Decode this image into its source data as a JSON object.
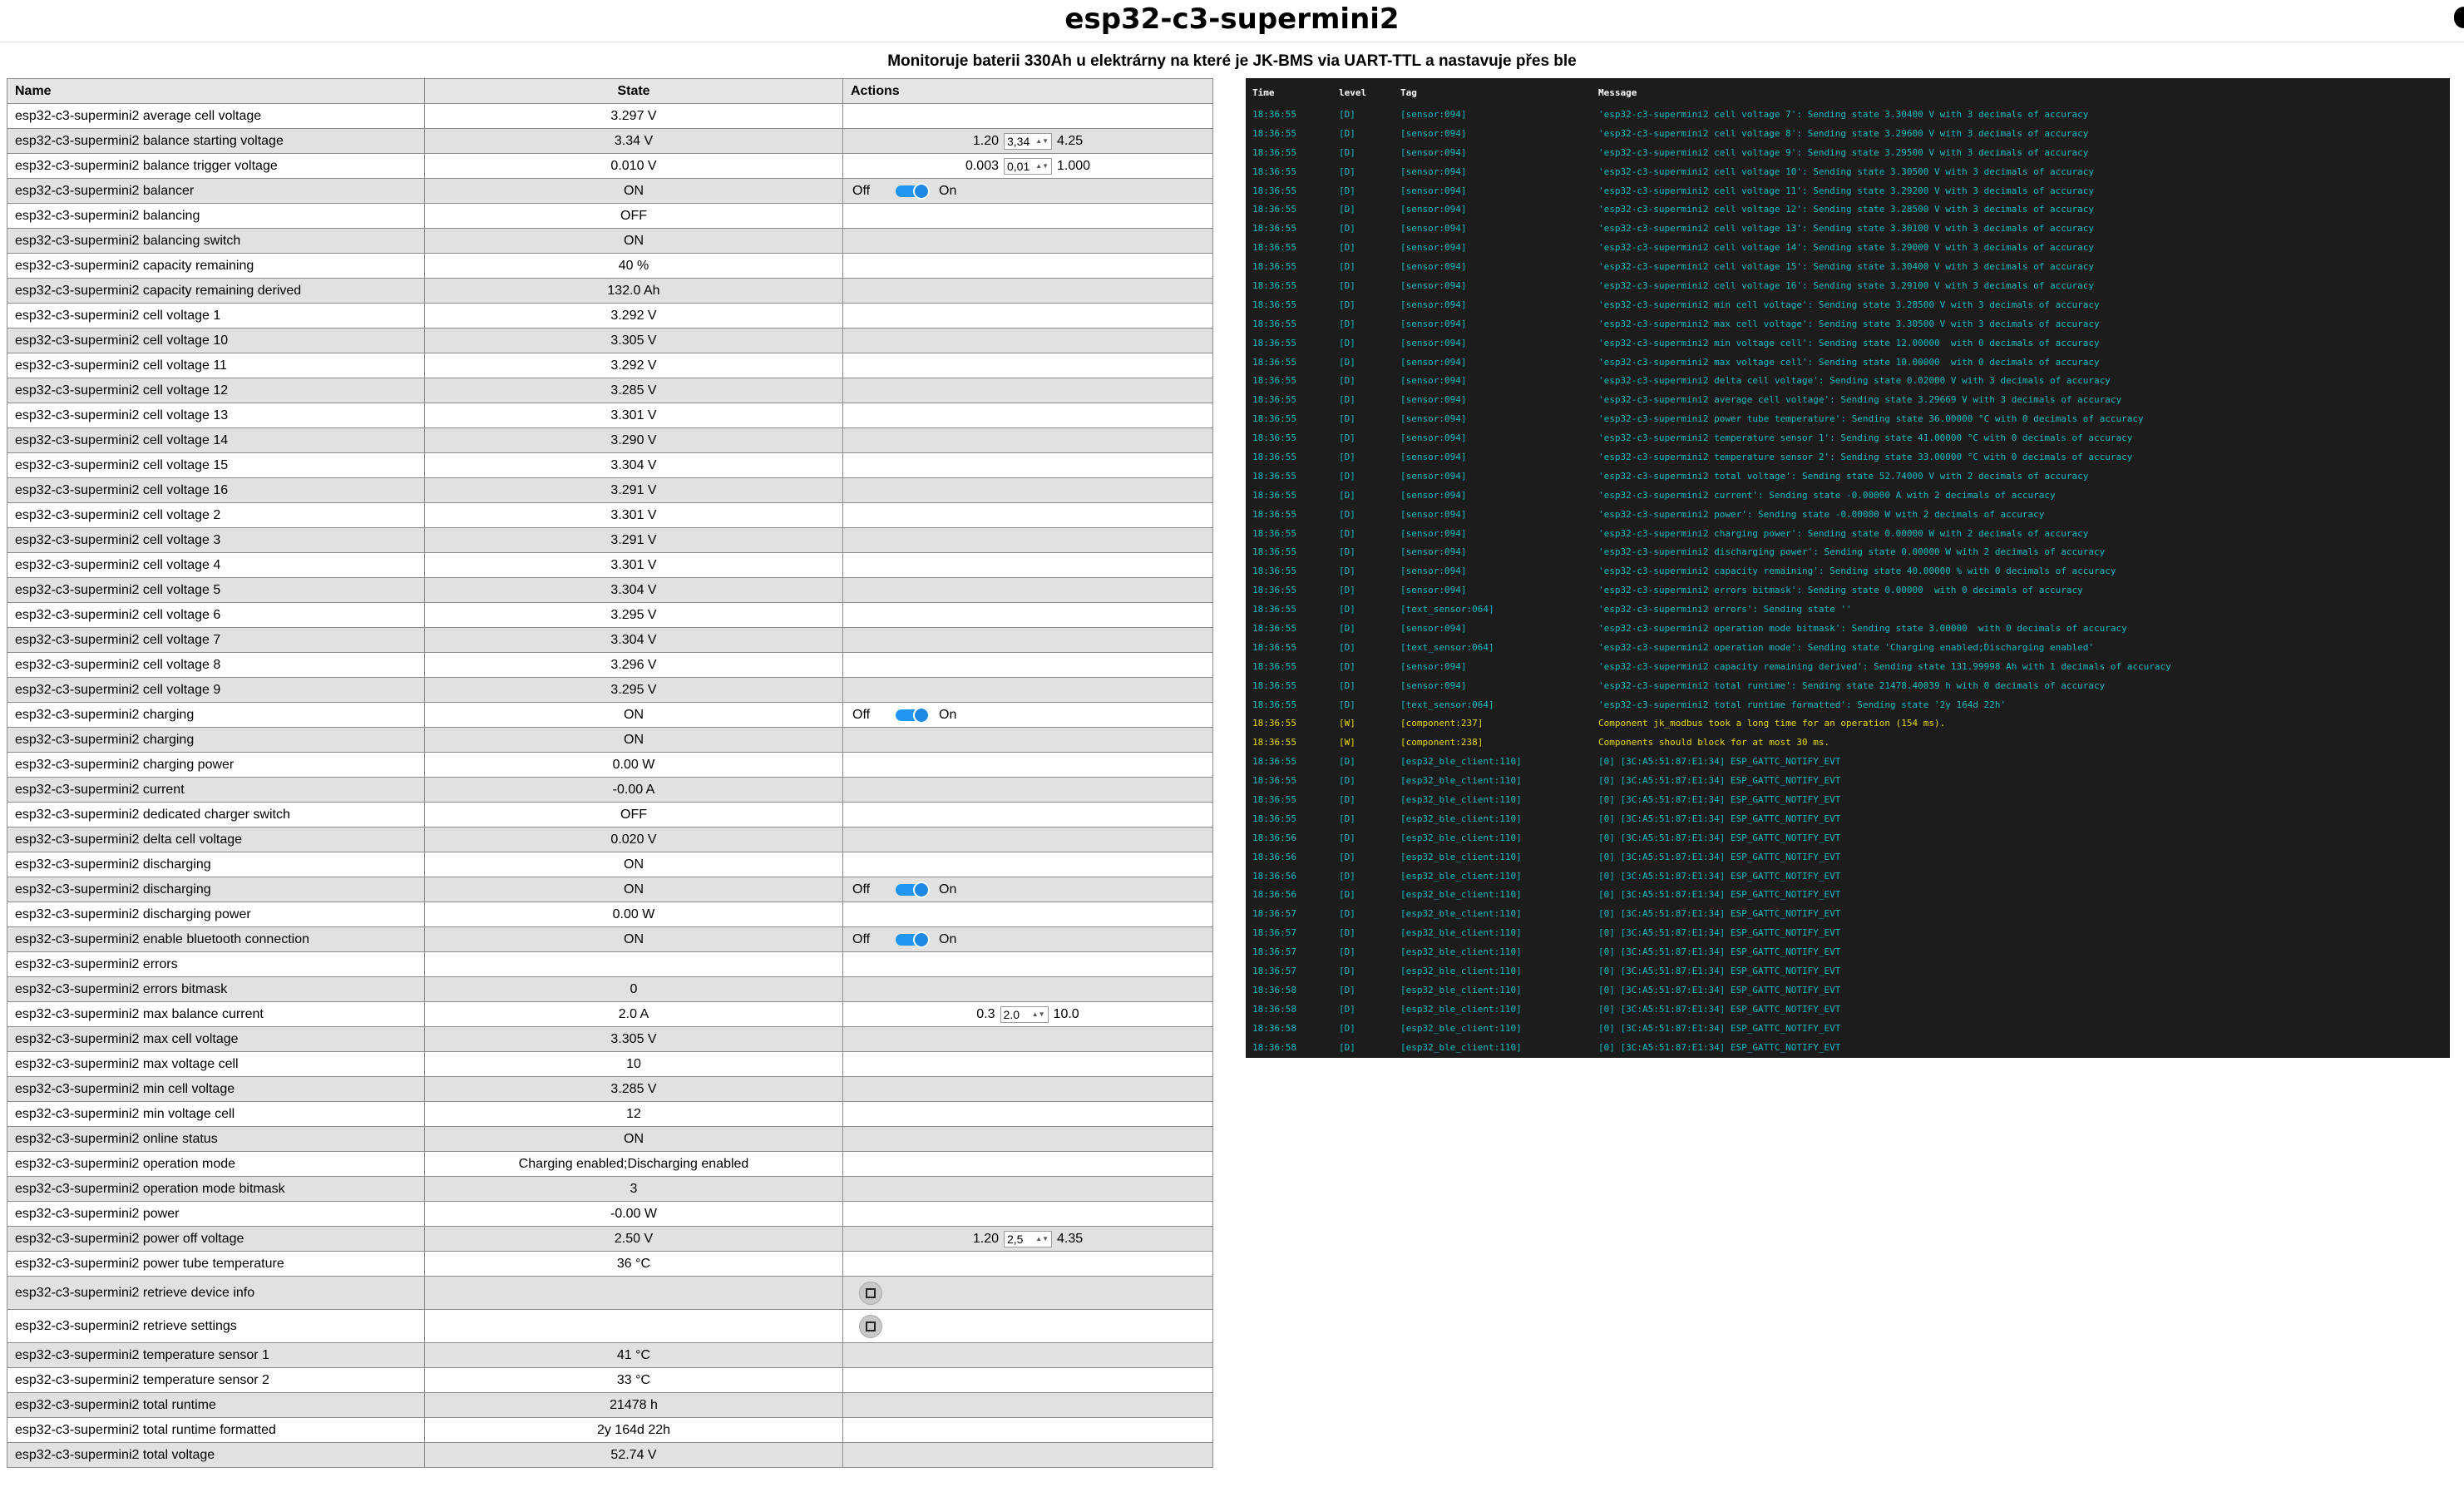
{
  "header": {
    "title": "esp32-c3-supermini2",
    "subtitle": "Monitoruje baterii 330Ah u elektrárny na které je JK-BMS via UART-TTL a nastavuje přes ble"
  },
  "table": {
    "columns": [
      "Name",
      "State",
      "Actions"
    ],
    "rows": [
      {
        "name": "esp32-c3-supermini2 average cell voltage",
        "state": "3.297 V"
      },
      {
        "name": "esp32-c3-supermini2 balance starting voltage",
        "state": "3.34 V",
        "action": {
          "kind": "number",
          "min": "1.20",
          "value": "3,34",
          "max": "4.25"
        }
      },
      {
        "name": "esp32-c3-supermini2 balance trigger voltage",
        "state": "0.010 V",
        "action": {
          "kind": "number",
          "min": "0.003",
          "value": "0,01",
          "max": "1.000"
        }
      },
      {
        "name": "esp32-c3-supermini2 balancer",
        "state": "ON",
        "action": {
          "kind": "switch",
          "off": "Off",
          "on": "On"
        }
      },
      {
        "name": "esp32-c3-supermini2 balancing",
        "state": "OFF"
      },
      {
        "name": "esp32-c3-supermini2 balancing switch",
        "state": "ON"
      },
      {
        "name": "esp32-c3-supermini2 capacity remaining",
        "state": "40 %"
      },
      {
        "name": "esp32-c3-supermini2 capacity remaining derived",
        "state": "132.0 Ah"
      },
      {
        "name": "esp32-c3-supermini2 cell voltage 1",
        "state": "3.292 V"
      },
      {
        "name": "esp32-c3-supermini2 cell voltage 10",
        "state": "3.305 V"
      },
      {
        "name": "esp32-c3-supermini2 cell voltage 11",
        "state": "3.292 V"
      },
      {
        "name": "esp32-c3-supermini2 cell voltage 12",
        "state": "3.285 V"
      },
      {
        "name": "esp32-c3-supermini2 cell voltage 13",
        "state": "3.301 V"
      },
      {
        "name": "esp32-c3-supermini2 cell voltage 14",
        "state": "3.290 V"
      },
      {
        "name": "esp32-c3-supermini2 cell voltage 15",
        "state": "3.304 V"
      },
      {
        "name": "esp32-c3-supermini2 cell voltage 16",
        "state": "3.291 V"
      },
      {
        "name": "esp32-c3-supermini2 cell voltage 2",
        "state": "3.301 V"
      },
      {
        "name": "esp32-c3-supermini2 cell voltage 3",
        "state": "3.291 V"
      },
      {
        "name": "esp32-c3-supermini2 cell voltage 4",
        "state": "3.301 V"
      },
      {
        "name": "esp32-c3-supermini2 cell voltage 5",
        "state": "3.304 V"
      },
      {
        "name": "esp32-c3-supermini2 cell voltage 6",
        "state": "3.295 V"
      },
      {
        "name": "esp32-c3-supermini2 cell voltage 7",
        "state": "3.304 V"
      },
      {
        "name": "esp32-c3-supermini2 cell voltage 8",
        "state": "3.296 V"
      },
      {
        "name": "esp32-c3-supermini2 cell voltage 9",
        "state": "3.295 V"
      },
      {
        "name": "esp32-c3-supermini2 charging",
        "state": "ON",
        "action": {
          "kind": "switch",
          "off": "Off",
          "on": "On"
        }
      },
      {
        "name": "esp32-c3-supermini2 charging",
        "state": "ON"
      },
      {
        "name": "esp32-c3-supermini2 charging power",
        "state": "0.00 W"
      },
      {
        "name": "esp32-c3-supermini2 current",
        "state": "-0.00 A"
      },
      {
        "name": "esp32-c3-supermini2 dedicated charger switch",
        "state": "OFF"
      },
      {
        "name": "esp32-c3-supermini2 delta cell voltage",
        "state": "0.020 V"
      },
      {
        "name": "esp32-c3-supermini2 discharging",
        "state": "ON"
      },
      {
        "name": "esp32-c3-supermini2 discharging",
        "state": "ON",
        "action": {
          "kind": "switch",
          "off": "Off",
          "on": "On"
        }
      },
      {
        "name": "esp32-c3-supermini2 discharging power",
        "state": "0.00 W"
      },
      {
        "name": "esp32-c3-supermini2 enable bluetooth connection",
        "state": "ON",
        "action": {
          "kind": "switch",
          "off": "Off",
          "on": "On"
        }
      },
      {
        "name": "esp32-c3-supermini2 errors",
        "state": ""
      },
      {
        "name": "esp32-c3-supermini2 errors bitmask",
        "state": "0"
      },
      {
        "name": "esp32-c3-supermini2 max balance current",
        "state": "2.0 A",
        "action": {
          "kind": "number",
          "min": "0.3",
          "value": "2.0",
          "max": "10.0"
        }
      },
      {
        "name": "esp32-c3-supermini2 max cell voltage",
        "state": "3.305 V"
      },
      {
        "name": "esp32-c3-supermini2 max voltage cell",
        "state": "10"
      },
      {
        "name": "esp32-c3-supermini2 min cell voltage",
        "state": "3.285 V"
      },
      {
        "name": "esp32-c3-supermini2 min voltage cell",
        "state": "12"
      },
      {
        "name": "esp32-c3-supermini2 online status",
        "state": "ON"
      },
      {
        "name": "esp32-c3-supermini2 operation mode",
        "state": "Charging enabled;Discharging enabled"
      },
      {
        "name": "esp32-c3-supermini2 operation mode bitmask",
        "state": "3"
      },
      {
        "name": "esp32-c3-supermini2 power",
        "state": "-0.00 W"
      },
      {
        "name": "esp32-c3-supermini2 power off voltage",
        "state": "2.50 V",
        "action": {
          "kind": "number",
          "min": "1.20",
          "value": "2,5",
          "max": "4.35"
        }
      },
      {
        "name": "esp32-c3-supermini2 power tube temperature",
        "state": "36 °C"
      },
      {
        "name": "esp32-c3-supermini2 retrieve device info",
        "state": "",
        "action": {
          "kind": "button"
        }
      },
      {
        "name": "esp32-c3-supermini2 retrieve settings",
        "state": "",
        "action": {
          "kind": "button"
        }
      },
      {
        "name": "esp32-c3-supermini2 temperature sensor 1",
        "state": "41 °C"
      },
      {
        "name": "esp32-c3-supermini2 temperature sensor 2",
        "state": "33 °C"
      },
      {
        "name": "esp32-c3-supermini2 total runtime",
        "state": "21478 h"
      },
      {
        "name": "esp32-c3-supermini2 total runtime formatted",
        "state": "2y 164d 22h"
      },
      {
        "name": "esp32-c3-supermini2 total voltage",
        "state": "52.74 V"
      }
    ]
  },
  "log": {
    "columns": [
      "Time",
      "level",
      "Tag",
      "Message"
    ],
    "rows": [
      {
        "time": "18:36:55",
        "level": "[D]",
        "tag": "[sensor:094]",
        "msg": "'esp32-c3-supermini2 cell voltage 7': Sending state 3.30400 V with 3 decimals of accuracy"
      },
      {
        "time": "18:36:55",
        "level": "[D]",
        "tag": "[sensor:094]",
        "msg": "'esp32-c3-supermini2 cell voltage 8': Sending state 3.29600 V with 3 decimals of accuracy"
      },
      {
        "time": "18:36:55",
        "level": "[D]",
        "tag": "[sensor:094]",
        "msg": "'esp32-c3-supermini2 cell voltage 9': Sending state 3.29500 V with 3 decimals of accuracy"
      },
      {
        "time": "18:36:55",
        "level": "[D]",
        "tag": "[sensor:094]",
        "msg": "'esp32-c3-supermini2 cell voltage 10': Sending state 3.30500 V with 3 decimals of accuracy"
      },
      {
        "time": "18:36:55",
        "level": "[D]",
        "tag": "[sensor:094]",
        "msg": "'esp32-c3-supermini2 cell voltage 11': Sending state 3.29200 V with 3 decimals of accuracy"
      },
      {
        "time": "18:36:55",
        "level": "[D]",
        "tag": "[sensor:094]",
        "msg": "'esp32-c3-supermini2 cell voltage 12': Sending state 3.28500 V with 3 decimals of accuracy"
      },
      {
        "time": "18:36:55",
        "level": "[D]",
        "tag": "[sensor:094]",
        "msg": "'esp32-c3-supermini2 cell voltage 13': Sending state 3.30100 V with 3 decimals of accuracy"
      },
      {
        "time": "18:36:55",
        "level": "[D]",
        "tag": "[sensor:094]",
        "msg": "'esp32-c3-supermini2 cell voltage 14': Sending state 3.29000 V with 3 decimals of accuracy"
      },
      {
        "time": "18:36:55",
        "level": "[D]",
        "tag": "[sensor:094]",
        "msg": "'esp32-c3-supermini2 cell voltage 15': Sending state 3.30400 V with 3 decimals of accuracy"
      },
      {
        "time": "18:36:55",
        "level": "[D]",
        "tag": "[sensor:094]",
        "msg": "'esp32-c3-supermini2 cell voltage 16': Sending state 3.29100 V with 3 decimals of accuracy"
      },
      {
        "time": "18:36:55",
        "level": "[D]",
        "tag": "[sensor:094]",
        "msg": "'esp32-c3-supermini2 min cell voltage': Sending state 3.28500 V with 3 decimals of accuracy"
      },
      {
        "time": "18:36:55",
        "level": "[D]",
        "tag": "[sensor:094]",
        "msg": "'esp32-c3-supermini2 max cell voltage': Sending state 3.30500 V with 3 decimals of accuracy"
      },
      {
        "time": "18:36:55",
        "level": "[D]",
        "tag": "[sensor:094]",
        "msg": "'esp32-c3-supermini2 min voltage cell': Sending state 12.00000  with 0 decimals of accuracy"
      },
      {
        "time": "18:36:55",
        "level": "[D]",
        "tag": "[sensor:094]",
        "msg": "'esp32-c3-supermini2 max voltage cell': Sending state 10.00000  with 0 decimals of accuracy"
      },
      {
        "time": "18:36:55",
        "level": "[D]",
        "tag": "[sensor:094]",
        "msg": "'esp32-c3-supermini2 delta cell voltage': Sending state 0.02000 V with 3 decimals of accuracy"
      },
      {
        "time": "18:36:55",
        "level": "[D]",
        "tag": "[sensor:094]",
        "msg": "'esp32-c3-supermini2 average cell voltage': Sending state 3.29669 V with 3 decimals of accuracy"
      },
      {
        "time": "18:36:55",
        "level": "[D]",
        "tag": "[sensor:094]",
        "msg": "'esp32-c3-supermini2 power tube temperature': Sending state 36.00000 °C with 0 decimals of accuracy"
      },
      {
        "time": "18:36:55",
        "level": "[D]",
        "tag": "[sensor:094]",
        "msg": "'esp32-c3-supermini2 temperature sensor 1': Sending state 41.00000 °C with 0 decimals of accuracy"
      },
      {
        "time": "18:36:55",
        "level": "[D]",
        "tag": "[sensor:094]",
        "msg": "'esp32-c3-supermini2 temperature sensor 2': Sending state 33.00000 °C with 0 decimals of accuracy"
      },
      {
        "time": "18:36:55",
        "level": "[D]",
        "tag": "[sensor:094]",
        "msg": "'esp32-c3-supermini2 total voltage': Sending state 52.74000 V with 2 decimals of accuracy"
      },
      {
        "time": "18:36:55",
        "level": "[D]",
        "tag": "[sensor:094]",
        "msg": "'esp32-c3-supermini2 current': Sending state -0.00000 A with 2 decimals of accuracy"
      },
      {
        "time": "18:36:55",
        "level": "[D]",
        "tag": "[sensor:094]",
        "msg": "'esp32-c3-supermini2 power': Sending state -0.00000 W with 2 decimals of accuracy"
      },
      {
        "time": "18:36:55",
        "level": "[D]",
        "tag": "[sensor:094]",
        "msg": "'esp32-c3-supermini2 charging power': Sending state 0.00000 W with 2 decimals of accuracy"
      },
      {
        "time": "18:36:55",
        "level": "[D]",
        "tag": "[sensor:094]",
        "msg": "'esp32-c3-supermini2 discharging power': Sending state 0.00000 W with 2 decimals of accuracy"
      },
      {
        "time": "18:36:55",
        "level": "[D]",
        "tag": "[sensor:094]",
        "msg": "'esp32-c3-supermini2 capacity remaining': Sending state 40.00000 % with 0 decimals of accuracy"
      },
      {
        "time": "18:36:55",
        "level": "[D]",
        "tag": "[sensor:094]",
        "msg": "'esp32-c3-supermini2 errors bitmask': Sending state 0.00000  with 0 decimals of accuracy"
      },
      {
        "time": "18:36:55",
        "level": "[D]",
        "tag": "[text_sensor:064]",
        "msg": "'esp32-c3-supermini2 errors': Sending state ''"
      },
      {
        "time": "18:36:55",
        "level": "[D]",
        "tag": "[sensor:094]",
        "msg": "'esp32-c3-supermini2 operation mode bitmask': Sending state 3.00000  with 0 decimals of accuracy"
      },
      {
        "time": "18:36:55",
        "level": "[D]",
        "tag": "[text_sensor:064]",
        "msg": "'esp32-c3-supermini2 operation mode': Sending state 'Charging enabled;Discharging enabled'"
      },
      {
        "time": "18:36:55",
        "level": "[D]",
        "tag": "[sensor:094]",
        "msg": "'esp32-c3-supermini2 capacity remaining derived': Sending state 131.99998 Ah with 1 decimals of accuracy"
      },
      {
        "time": "18:36:55",
        "level": "[D]",
        "tag": "[sensor:094]",
        "msg": "'esp32-c3-supermini2 total runtime': Sending state 21478.40039 h with 0 decimals of accuracy"
      },
      {
        "time": "18:36:55",
        "level": "[D]",
        "tag": "[text_sensor:064]",
        "msg": "'esp32-c3-supermini2 total runtime formatted': Sending state '2y 164d 22h'"
      },
      {
        "time": "18:36:55",
        "level": "[W]",
        "tag": "[component:237]",
        "msg": "Component jk_modbus took a long time for an operation (154 ms)."
      },
      {
        "time": "18:36:55",
        "level": "[W]",
        "tag": "[component:238]",
        "msg": "Components should block for at most 30 ms."
      },
      {
        "time": "18:36:55",
        "level": "[D]",
        "tag": "[esp32_ble_client:110]",
        "msg": "[0] [3C:A5:51:87:E1:34] ESP_GATTC_NOTIFY_EVT"
      },
      {
        "time": "18:36:55",
        "level": "[D]",
        "tag": "[esp32_ble_client:110]",
        "msg": "[0] [3C:A5:51:87:E1:34] ESP_GATTC_NOTIFY_EVT"
      },
      {
        "time": "18:36:55",
        "level": "[D]",
        "tag": "[esp32_ble_client:110]",
        "msg": "[0] [3C:A5:51:87:E1:34] ESP_GATTC_NOTIFY_EVT"
      },
      {
        "time": "18:36:55",
        "level": "[D]",
        "tag": "[esp32_ble_client:110]",
        "msg": "[0] [3C:A5:51:87:E1:34] ESP_GATTC_NOTIFY_EVT"
      },
      {
        "time": "18:36:56",
        "level": "[D]",
        "tag": "[esp32_ble_client:110]",
        "msg": "[0] [3C:A5:51:87:E1:34] ESP_GATTC_NOTIFY_EVT"
      },
      {
        "time": "18:36:56",
        "level": "[D]",
        "tag": "[esp32_ble_client:110]",
        "msg": "[0] [3C:A5:51:87:E1:34] ESP_GATTC_NOTIFY_EVT"
      },
      {
        "time": "18:36:56",
        "level": "[D]",
        "tag": "[esp32_ble_client:110]",
        "msg": "[0] [3C:A5:51:87:E1:34] ESP_GATTC_NOTIFY_EVT"
      },
      {
        "time": "18:36:56",
        "level": "[D]",
        "tag": "[esp32_ble_client:110]",
        "msg": "[0] [3C:A5:51:87:E1:34] ESP_GATTC_NOTIFY_EVT"
      },
      {
        "time": "18:36:57",
        "level": "[D]",
        "tag": "[esp32_ble_client:110]",
        "msg": "[0] [3C:A5:51:87:E1:34] ESP_GATTC_NOTIFY_EVT"
      },
      {
        "time": "18:36:57",
        "level": "[D]",
        "tag": "[esp32_ble_client:110]",
        "msg": "[0] [3C:A5:51:87:E1:34] ESP_GATTC_NOTIFY_EVT"
      },
      {
        "time": "18:36:57",
        "level": "[D]",
        "tag": "[esp32_ble_client:110]",
        "msg": "[0] [3C:A5:51:87:E1:34] ESP_GATTC_NOTIFY_EVT"
      },
      {
        "time": "18:36:57",
        "level": "[D]",
        "tag": "[esp32_ble_client:110]",
        "msg": "[0] [3C:A5:51:87:E1:34] ESP_GATTC_NOTIFY_EVT"
      },
      {
        "time": "18:36:58",
        "level": "[D]",
        "tag": "[esp32_ble_client:110]",
        "msg": "[0] [3C:A5:51:87:E1:34] ESP_GATTC_NOTIFY_EVT"
      },
      {
        "time": "18:36:58",
        "level": "[D]",
        "tag": "[esp32_ble_client:110]",
        "msg": "[0] [3C:A5:51:87:E1:34] ESP_GATTC_NOTIFY_EVT"
      },
      {
        "time": "18:36:58",
        "level": "[D]",
        "tag": "[esp32_ble_client:110]",
        "msg": "[0] [3C:A5:51:87:E1:34] ESP_GATTC_NOTIFY_EVT"
      },
      {
        "time": "18:36:58",
        "level": "[D]",
        "tag": "[esp32_ble_client:110]",
        "msg": "[0] [3C:A5:51:87:E1:34] ESP_GATTC_NOTIFY_EVT"
      }
    ]
  },
  "colors": {
    "log_bg": "#1c1c1c",
    "log_debug": "#13b8c2",
    "log_warning": "#e6d80f",
    "switch_on": "#2196f3"
  }
}
